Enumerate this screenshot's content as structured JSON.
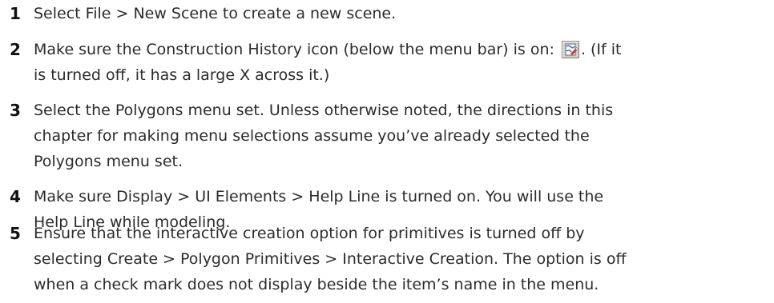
{
  "steps": [
    {
      "number": "1",
      "lines": [
        "Select File > New Scene to create a new scene."
      ]
    },
    {
      "number": "2",
      "line1_before_icon": "Make sure the Construction History icon (below the menu bar) is on: ",
      "line1_after_icon": ". (If it",
      "line2": "is turned off, it has a large X across it.)",
      "icon": "construction-history-icon"
    },
    {
      "number": "3",
      "lines": [
        "Select the Polygons menu set. Unless otherwise noted, the directions in this",
        "chapter for making menu selections assume you’ve already selected the",
        "Polygons menu set."
      ]
    },
    {
      "number": "4",
      "lines": [
        "Make sure Display > UI Elements > Help Line is turned on. You will use the",
        "Help Line while modeling."
      ]
    },
    {
      "number": "5",
      "lines": [
        "Ensure that the interactive creation option for primitives is turned off by",
        "selecting Create > Polygon Primitives > Interactive Creation. The option is off",
        "when a check mark does not display beside the item’s name in the menu."
      ]
    }
  ]
}
